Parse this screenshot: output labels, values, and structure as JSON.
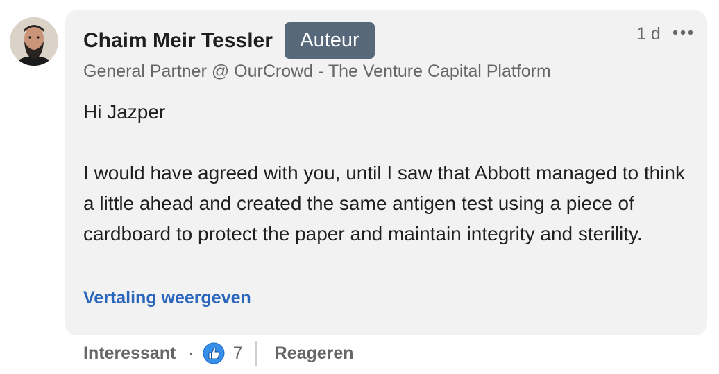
{
  "comment": {
    "author": {
      "name": "Chaim Meir Tessler",
      "badge": "Auteur",
      "headline": "General Partner @ OurCrowd - The Venture Capital Platform",
      "avatar_icon": "profile-photo"
    },
    "timestamp": "1 d",
    "more_icon": "ellipsis-icon",
    "body": {
      "line1": "Hi Jazper",
      "line2": "I would have agreed with you, until I saw that Abbott managed to think a little ahead and created the same antigen test using a piece of cardboard to protect the paper and maintain integrity and sterility."
    },
    "translate_link": "Vertaling weergeven"
  },
  "actions": {
    "reaction_label": "Interessant",
    "separator": "·",
    "reaction_icon": "thumbs-up-icon",
    "reaction_count": "7",
    "reply_label": "Reageren"
  },
  "colors": {
    "bubble_bg": "#f2f2f2",
    "badge_bg": "#56687a",
    "link_blue": "#2a66bc",
    "like_blue": "#378fe9"
  }
}
